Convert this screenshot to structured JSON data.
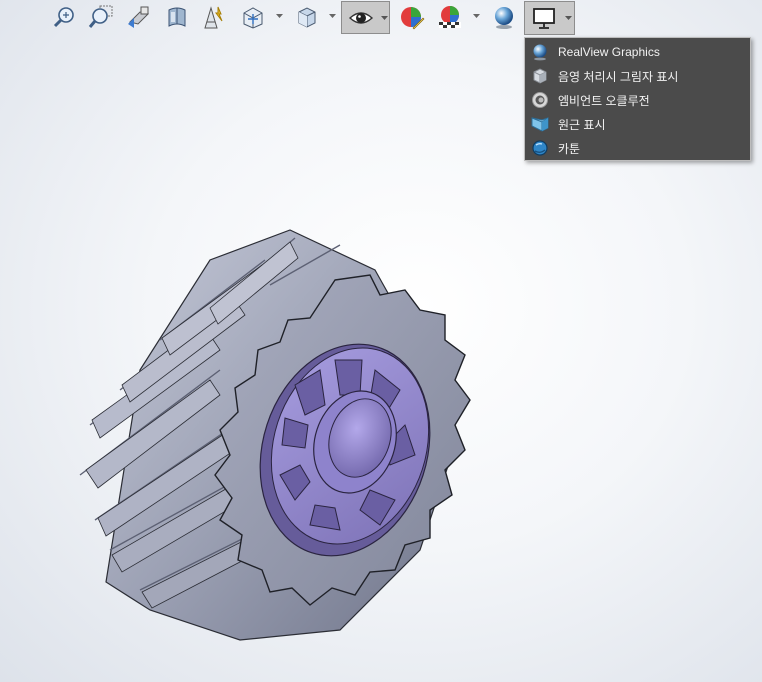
{
  "toolbar": {
    "buttons": [
      {
        "icon": "zoom-to-fit-icon"
      },
      {
        "icon": "zoom-to-area-icon"
      },
      {
        "icon": "previous-view-icon"
      },
      {
        "icon": "section-view-icon"
      },
      {
        "icon": "dynamic-annotation-views-icon"
      },
      {
        "icon": "view-orientation-icon"
      },
      {
        "icon": "display-style-icon"
      },
      {
        "icon": "hide-show-items-icon",
        "pressed": true
      },
      {
        "icon": "edit-appearance-icon"
      },
      {
        "icon": "apply-scene-icon"
      },
      {
        "icon": "view-settings-icon"
      },
      {
        "icon": "display-settings-icon",
        "pressed": true
      }
    ]
  },
  "menu": {
    "items": [
      {
        "label": "RealView Graphics",
        "icon": "realview-sphere-icon"
      },
      {
        "label": "음영 처리시 그림자 표시",
        "icon": "shadows-cube-icon"
      },
      {
        "label": "엠비언트 오클루전",
        "icon": "ambient-occlusion-icon"
      },
      {
        "label": "원근 표시",
        "icon": "perspective-icon"
      },
      {
        "label": "카툰",
        "icon": "cartoon-sphere-icon"
      }
    ]
  },
  "colors": {
    "menu_bg": "#4b4b4b",
    "menu_text": "#f2f2f2",
    "gear_body": "#8e94a8",
    "gear_face": "#9b9fb3",
    "hub": "#8f84c6"
  }
}
